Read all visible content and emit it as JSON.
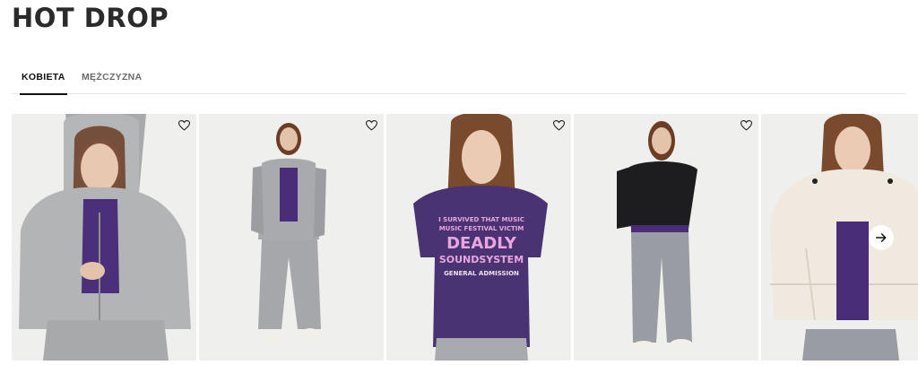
{
  "page": {
    "title": "HOT DROP"
  },
  "tabs": [
    {
      "label": "KOBIETA",
      "active": true
    },
    {
      "label": "MĘŻCZYZNA",
      "active": false
    }
  ],
  "products": [
    {
      "icon": "heart-icon",
      "colors": {
        "top": "#b4b5b7",
        "shirt": "#4b2f7a",
        "bottom": "#b0b1b3"
      }
    },
    {
      "icon": "heart-icon",
      "colors": {
        "top": "#a9aaad",
        "shirt": "#4a2d78",
        "bottom": "#a6a7aa"
      }
    },
    {
      "icon": "heart-icon",
      "colors": {
        "shirt": "#4a3372",
        "print": "#e9a6de",
        "bottom": "#a9aab0"
      }
    },
    {
      "icon": "heart-icon",
      "colors": {
        "top": "#1d1d1f",
        "shirt": "#4a2d78",
        "bottom": "#9a9ca4"
      }
    },
    {
      "icon": "heart-icon",
      "colors": {
        "top": "#f0e9df",
        "shirt": "#4a2d78",
        "bottom": "#9a9ca4"
      }
    }
  ],
  "carousel": {
    "next_icon": "arrow-right-icon"
  },
  "shirt_graphic": {
    "line1": "I SURVIVED THAT MUSIC",
    "line2": "MUSIC FESTIVAL VICTIM",
    "line3": "DEADLY",
    "line4": "SOUNDSYSTEM",
    "line5": "GENERAL ADMISSION"
  }
}
